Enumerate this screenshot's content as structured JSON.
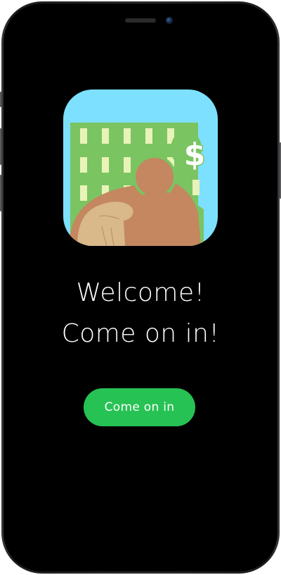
{
  "welcome": {
    "line1": "Welcome!",
    "line2": "Come on in!"
  },
  "cta": {
    "label": "Come on in"
  },
  "app_icon": {
    "symbol": "$",
    "icon_name": "landlord-handshake-icon"
  },
  "colors": {
    "screen_background": "#000000",
    "button_green": "#27c254",
    "text": "#ffffff",
    "icon_sky": "#7de0ff",
    "icon_building": "#7ac462",
    "icon_window": "#e9f3b8",
    "icon_person": "#c4875f",
    "icon_hand": "#d9b88a"
  }
}
